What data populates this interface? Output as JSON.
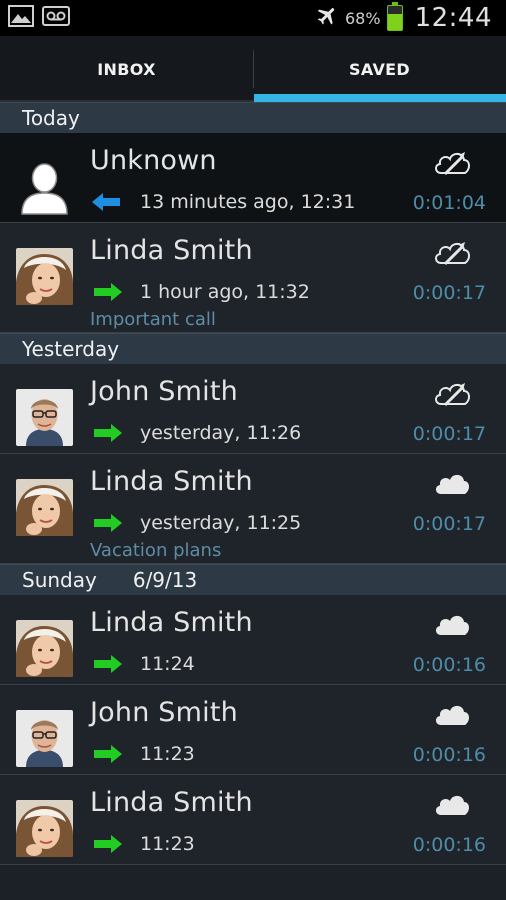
{
  "status_bar": {
    "icons_left": [
      "image-icon",
      "voicemail-icon"
    ],
    "icons_right": [
      "airplane-icon",
      "battery-icon"
    ],
    "battery_level": "68%",
    "time": "12:44"
  },
  "tabs": [
    {
      "label": "INBOX",
      "selected": false
    },
    {
      "label": "SAVED",
      "selected": true
    }
  ],
  "colors": {
    "accent": "#33b5e5",
    "incoming_arrow": "#1e8fe0",
    "outgoing_arrow": "#22cc22",
    "duration": "#4e8ca9"
  },
  "sections": [
    {
      "label": "Today",
      "date": ""
    },
    {
      "label": "Yesterday",
      "date": ""
    },
    {
      "label": "Sunday",
      "date": "6/9/13"
    }
  ],
  "calls": [
    {
      "name": "Unknown",
      "direction": "incoming",
      "time": "13 minutes ago, 12:31",
      "duration": "0:01:04",
      "note": "",
      "cloud": "cloud-syncing-icon",
      "avatar": "unknown-person-icon"
    },
    {
      "name": "Linda Smith",
      "direction": "outgoing",
      "time": "1 hour ago, 11:32",
      "duration": "0:00:17",
      "note": "Important call",
      "cloud": "cloud-syncing-icon",
      "avatar": "linda-avatar"
    },
    {
      "name": "John Smith",
      "direction": "outgoing",
      "time": "yesterday, 11:26",
      "duration": "0:00:17",
      "note": "",
      "cloud": "cloud-syncing-icon",
      "avatar": "john-avatar"
    },
    {
      "name": "Linda Smith",
      "direction": "outgoing",
      "time": "yesterday, 11:25",
      "duration": "0:00:17",
      "note": "Vacation plans",
      "cloud": "cloud-icon",
      "avatar": "linda-avatar"
    },
    {
      "name": "Linda Smith",
      "direction": "outgoing",
      "time": "11:24",
      "duration": "0:00:16",
      "note": "",
      "cloud": "cloud-icon",
      "avatar": "linda-avatar"
    },
    {
      "name": "John Smith",
      "direction": "outgoing",
      "time": "11:23",
      "duration": "0:00:16",
      "note": "",
      "cloud": "cloud-icon",
      "avatar": "john-avatar"
    },
    {
      "name": "Linda Smith",
      "direction": "outgoing",
      "time": "11:23",
      "duration": "0:00:16",
      "note": "",
      "cloud": "cloud-icon",
      "avatar": "linda-avatar"
    }
  ]
}
